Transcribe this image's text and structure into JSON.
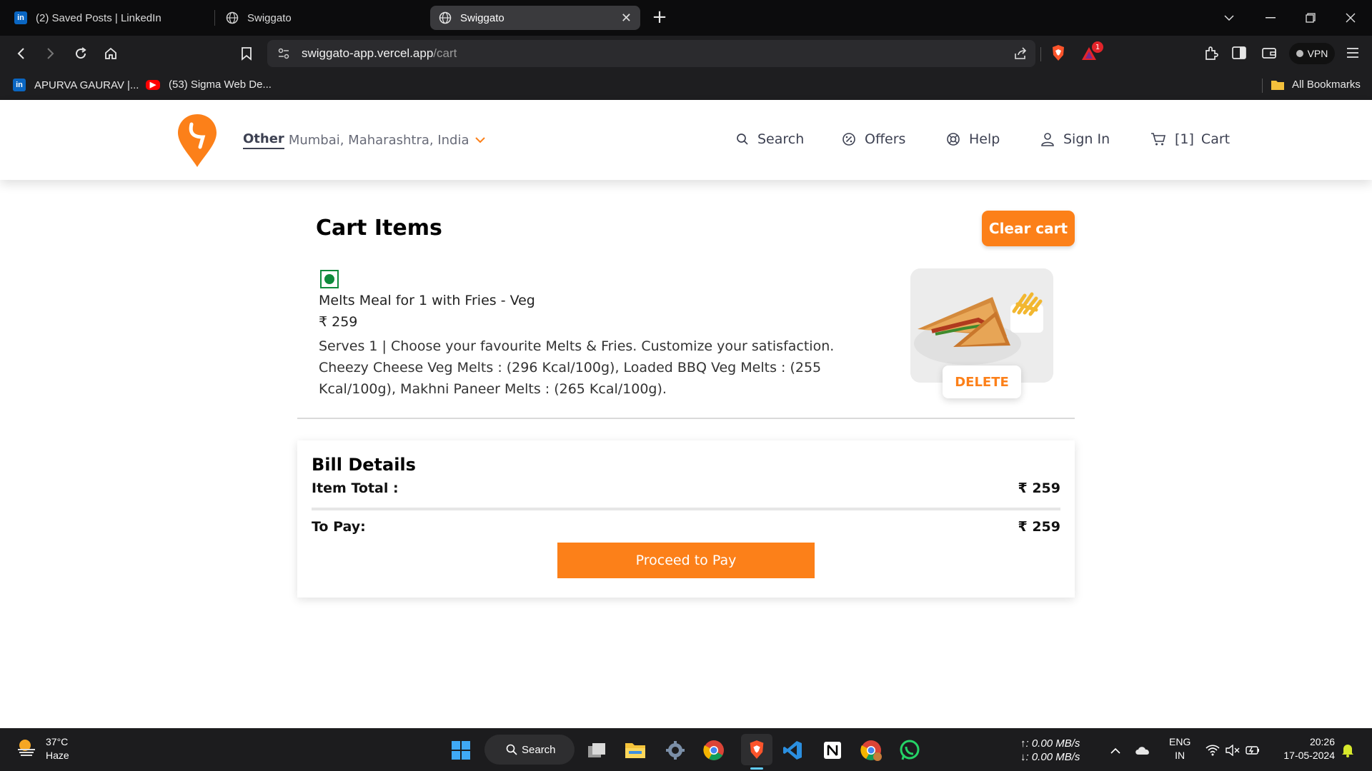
{
  "browser": {
    "tabs": [
      {
        "title": "(2) Saved Posts | LinkedIn",
        "icon": "linkedin-icon"
      },
      {
        "title": "Swiggato",
        "icon": "globe-icon"
      },
      {
        "title": "Swiggato",
        "icon": "globe-icon",
        "active": true
      }
    ],
    "url_domain": "swiggato-app.vercel.app",
    "url_path": "/cart",
    "vpn_label": "VPN",
    "brave_rewards_badge": "1",
    "bookmarks": [
      {
        "label": "APURVA GAURAV |...",
        "icon": "linkedin-icon"
      },
      {
        "label": "(53) Sigma Web De...",
        "icon": "youtube-icon"
      }
    ],
    "all_bookmarks_label": "All Bookmarks"
  },
  "header": {
    "location_type": "Other",
    "location": "Mumbai, Maharashtra, India",
    "nav": {
      "search": "Search",
      "offers": "Offers",
      "help": "Help",
      "sign_in": "Sign In",
      "cart_count": "[1]",
      "cart": "Cart"
    }
  },
  "cart": {
    "title": "Cart Items",
    "clear_label": "Clear cart",
    "items": [
      {
        "name": "Melts Meal for 1 with Fries - Veg",
        "price": "₹ 259",
        "description": "Serves 1 | Choose your favourite Melts & Fries. Customize your satisfaction. Cheezy Cheese Veg Melts : (296 Kcal/100g), Loaded BBQ Veg Melts : (255 Kcal/100g), Makhni Paneer Melts : (265 Kcal/100g).",
        "delete_label": "DELETE",
        "veg": true
      }
    ]
  },
  "bill": {
    "title": "Bill Details",
    "item_total_label": "Item Total :",
    "item_total_value": "₹ 259",
    "to_pay_label": "To Pay:",
    "to_pay_value": "₹ 259",
    "pay_button": "Proceed to Pay"
  },
  "taskbar": {
    "weather_temp": "37°C",
    "weather_desc": "Haze",
    "search_label": "Search",
    "net_up": "0.00 MB/s",
    "net_down": "0.00 MB/s",
    "lang": "ENG",
    "region": "IN",
    "time": "20:26",
    "date": "17-05-2024"
  },
  "colors": {
    "accent": "#fc8019",
    "veg": "#0f8a3c",
    "text": "#3d4152"
  }
}
